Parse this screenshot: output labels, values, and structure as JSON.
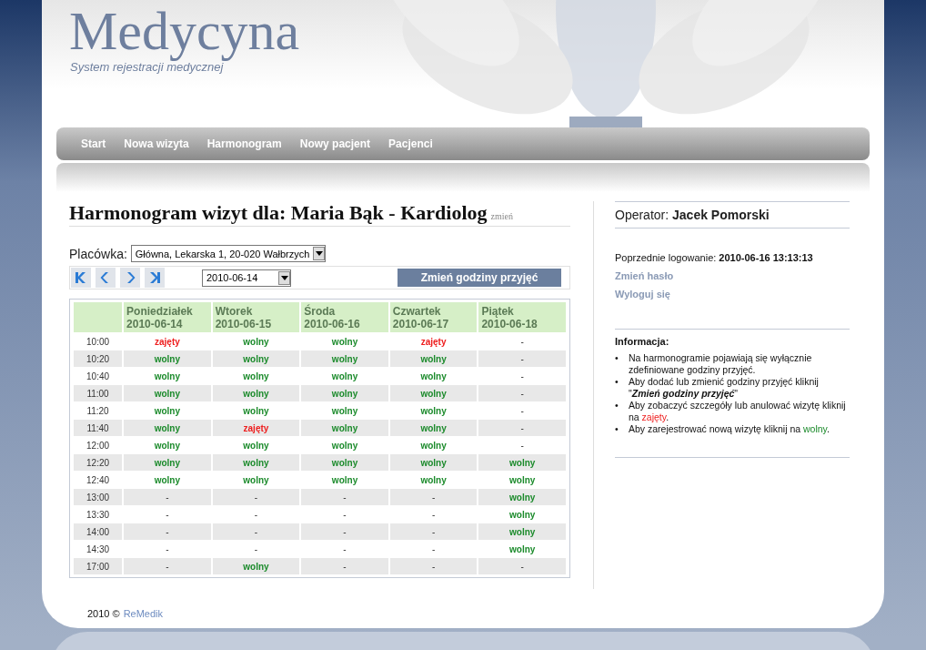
{
  "header": {
    "title": "Medycyna",
    "subtitle": "System rejestracji medycznej"
  },
  "nav": [
    {
      "label": "Start"
    },
    {
      "label": "Nowa wizyta"
    },
    {
      "label": "Harmonogram"
    },
    {
      "label": "Nowy pacjent"
    },
    {
      "label": "Pacjenci"
    }
  ],
  "schedule": {
    "heading": "Harmonogram wizyt dla: Maria Bąk - Kardiolog",
    "change_link": "zmień",
    "facility_label": "Placówka:",
    "facility": "Główna, Lekarska 1, 20-020 Wałbrzych",
    "date": "2010-06-14",
    "change_hours_button": "Zmień godziny przyjęć",
    "columns": [
      {
        "day": "Poniedziałek",
        "date": "2010-06-14"
      },
      {
        "day": "Wtorek",
        "date": "2010-06-15"
      },
      {
        "day": "Środa",
        "date": "2010-06-16"
      },
      {
        "day": "Czwartek",
        "date": "2010-06-17"
      },
      {
        "day": "Piątek",
        "date": "2010-06-18"
      }
    ],
    "rows": [
      {
        "time": "10:00",
        "slots": [
          {
            "kind": "busy",
            "text": "zajęty"
          },
          {
            "kind": "free",
            "text": "wolny"
          },
          {
            "kind": "free",
            "text": "wolny"
          },
          {
            "kind": "busy",
            "text": "zajęty"
          },
          {
            "kind": "none",
            "text": "-"
          }
        ]
      },
      {
        "time": "10:20",
        "slots": [
          {
            "kind": "free",
            "text": "wolny"
          },
          {
            "kind": "free",
            "text": "wolny"
          },
          {
            "kind": "free",
            "text": "wolny"
          },
          {
            "kind": "free",
            "text": "wolny"
          },
          {
            "kind": "none",
            "text": "-"
          }
        ]
      },
      {
        "time": "10:40",
        "slots": [
          {
            "kind": "free",
            "text": "wolny"
          },
          {
            "kind": "free",
            "text": "wolny"
          },
          {
            "kind": "free",
            "text": "wolny"
          },
          {
            "kind": "free",
            "text": "wolny"
          },
          {
            "kind": "none",
            "text": "-"
          }
        ]
      },
      {
        "time": "11:00",
        "slots": [
          {
            "kind": "free",
            "text": "wolny"
          },
          {
            "kind": "free",
            "text": "wolny"
          },
          {
            "kind": "free",
            "text": "wolny"
          },
          {
            "kind": "free",
            "text": "wolny"
          },
          {
            "kind": "none",
            "text": "-"
          }
        ]
      },
      {
        "time": "11:20",
        "slots": [
          {
            "kind": "free",
            "text": "wolny"
          },
          {
            "kind": "free",
            "text": "wolny"
          },
          {
            "kind": "free",
            "text": "wolny"
          },
          {
            "kind": "free",
            "text": "wolny"
          },
          {
            "kind": "none",
            "text": "-"
          }
        ]
      },
      {
        "time": "11:40",
        "slots": [
          {
            "kind": "free",
            "text": "wolny"
          },
          {
            "kind": "busy",
            "text": "zajęty"
          },
          {
            "kind": "free",
            "text": "wolny"
          },
          {
            "kind": "free",
            "text": "wolny"
          },
          {
            "kind": "none",
            "text": "-"
          }
        ]
      },
      {
        "time": "12:00",
        "slots": [
          {
            "kind": "free",
            "text": "wolny"
          },
          {
            "kind": "free",
            "text": "wolny"
          },
          {
            "kind": "free",
            "text": "wolny"
          },
          {
            "kind": "free",
            "text": "wolny"
          },
          {
            "kind": "none",
            "text": "-"
          }
        ]
      },
      {
        "time": "12:20",
        "slots": [
          {
            "kind": "free",
            "text": "wolny"
          },
          {
            "kind": "free",
            "text": "wolny"
          },
          {
            "kind": "free",
            "text": "wolny"
          },
          {
            "kind": "free",
            "text": "wolny"
          },
          {
            "kind": "free",
            "text": "wolny"
          }
        ]
      },
      {
        "time": "12:40",
        "slots": [
          {
            "kind": "free",
            "text": "wolny"
          },
          {
            "kind": "free",
            "text": "wolny"
          },
          {
            "kind": "free",
            "text": "wolny"
          },
          {
            "kind": "free",
            "text": "wolny"
          },
          {
            "kind": "free",
            "text": "wolny"
          }
        ]
      },
      {
        "time": "13:00",
        "slots": [
          {
            "kind": "none",
            "text": "-"
          },
          {
            "kind": "none",
            "text": "-"
          },
          {
            "kind": "none",
            "text": "-"
          },
          {
            "kind": "none",
            "text": "-"
          },
          {
            "kind": "free",
            "text": "wolny"
          }
        ]
      },
      {
        "time": "13:30",
        "slots": [
          {
            "kind": "none",
            "text": "-"
          },
          {
            "kind": "none",
            "text": "-"
          },
          {
            "kind": "none",
            "text": "-"
          },
          {
            "kind": "none",
            "text": "-"
          },
          {
            "kind": "free",
            "text": "wolny"
          }
        ]
      },
      {
        "time": "14:00",
        "slots": [
          {
            "kind": "none",
            "text": "-"
          },
          {
            "kind": "none",
            "text": "-"
          },
          {
            "kind": "none",
            "text": "-"
          },
          {
            "kind": "none",
            "text": "-"
          },
          {
            "kind": "free",
            "text": "wolny"
          }
        ]
      },
      {
        "time": "14:30",
        "slots": [
          {
            "kind": "none",
            "text": "-"
          },
          {
            "kind": "none",
            "text": "-"
          },
          {
            "kind": "none",
            "text": "-"
          },
          {
            "kind": "none",
            "text": "-"
          },
          {
            "kind": "free",
            "text": "wolny"
          }
        ]
      },
      {
        "time": "17:00",
        "slots": [
          {
            "kind": "none",
            "text": "-"
          },
          {
            "kind": "free",
            "text": "wolny"
          },
          {
            "kind": "none",
            "text": "-"
          },
          {
            "kind": "none",
            "text": "-"
          },
          {
            "kind": "none",
            "text": "-"
          }
        ]
      }
    ]
  },
  "sidebar": {
    "operator_label": "Operator:",
    "operator": "Jacek Pomorski",
    "last_login_label": "Poprzednie logowanie:",
    "last_login": "2010-06-16 13:13:13",
    "links": [
      "Zmień hasło",
      "Wyloguj się"
    ],
    "info_title": "Informacja:",
    "info": [
      {
        "bullet": "•",
        "parts": [
          {
            "kind": "plain",
            "text": "Na harmonogramie pojawiają się wyłącznie zdefiniowane godziny przyjęć."
          }
        ]
      },
      {
        "bullet": "•",
        "parts": [
          {
            "kind": "plain",
            "text": "Aby dodać lub zmienić godziny przyjęć kliknij \""
          },
          {
            "kind": "emph",
            "text": "Zmień godziny przyjęć"
          },
          {
            "kind": "plain",
            "text": "\""
          }
        ]
      },
      {
        "bullet": "•",
        "parts": [
          {
            "kind": "plain",
            "text": "Aby zobaczyć szczegóły lub anulować wizytę kliknij na "
          },
          {
            "kind": "busy",
            "text": "zajęty"
          },
          {
            "kind": "plain",
            "text": "."
          }
        ]
      },
      {
        "bullet": "•",
        "parts": [
          {
            "kind": "plain",
            "text": "Aby zarejestrować nową wizytę kliknij na "
          },
          {
            "kind": "free",
            "text": "wolny"
          },
          {
            "kind": "plain",
            "text": "."
          }
        ]
      }
    ]
  },
  "footer": {
    "copyright": "2010 ©",
    "link": "ReMedik"
  }
}
